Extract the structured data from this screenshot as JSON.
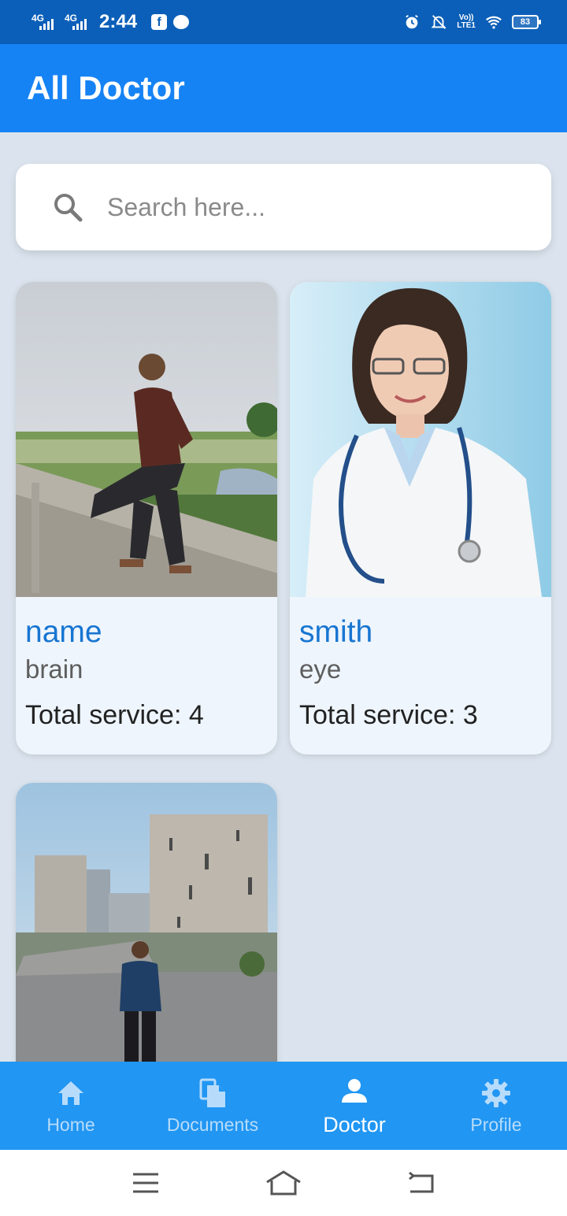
{
  "status_bar": {
    "network1": "4G",
    "network2": "4G",
    "time": "2:44",
    "lte_top": "Vo))",
    "lte_bottom": "LTE1",
    "battery": "83"
  },
  "app_bar": {
    "title": "All Doctor"
  },
  "search": {
    "placeholder": "Search here..."
  },
  "doctors": [
    {
      "name": "name",
      "specialty": "brain",
      "total_service": "Total service: 4"
    },
    {
      "name": "smith",
      "specialty": "eye",
      "total_service": "Total service: 3"
    },
    {
      "name": "",
      "specialty": "",
      "total_service": ""
    }
  ],
  "bottom_nav": {
    "items": [
      {
        "label": "Home",
        "icon": "home-icon",
        "active": false
      },
      {
        "label": "Documents",
        "icon": "documents-icon",
        "active": false
      },
      {
        "label": "Doctor",
        "icon": "person-icon",
        "active": true
      },
      {
        "label": "Profile",
        "icon": "gear-icon",
        "active": false
      }
    ]
  },
  "colors": {
    "status_bar": "#0b5fb8",
    "app_bar": "#1683f5",
    "bottom_nav": "#2196f3",
    "doctor_name": "#1775d1",
    "background": "#dbe4ee"
  }
}
